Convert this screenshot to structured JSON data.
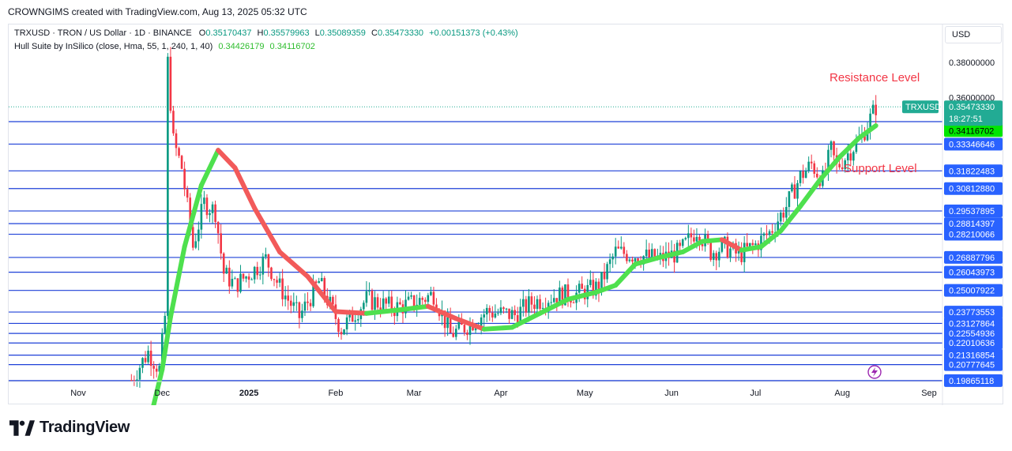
{
  "header": {
    "title": "CROWNGIMS created with TradingView.com, Aug 13, 2025 05:32 UTC"
  },
  "legend": {
    "symbol": "TRXUSD · TRON / US Dollar · 1D · BINANCE",
    "o_label": "O",
    "o_value": "0.35170437",
    "h_label": "H",
    "h_value": "0.35579963",
    "l_label": "L",
    "l_value": "0.35089359",
    "c_label": "C",
    "c_value": "0.35473330",
    "change": "+0.00151373 (+0.43%)",
    "indicator": "Hull Suite by InSilico (close, Hma, 55, 1, 240, 1, 40)",
    "indicator_v1": "0.34426179",
    "indicator_v2": "0.34116702"
  },
  "currency": "USD",
  "logo_text": "TradingView",
  "chart_data": {
    "type": "candlestick",
    "symbol": "TRXUSD",
    "ylim": [
      0.195,
      0.385
    ],
    "price_axis_labels": [
      "0.38000000",
      "0.36000000"
    ],
    "x_tick_labels": [
      "Nov",
      "Dec",
      "2025",
      "Feb",
      "Mar",
      "Apr",
      "May",
      "Jun",
      "Jul",
      "Aug",
      "Sep"
    ],
    "last_price": {
      "symbol": "TRXUSD",
      "value": 0.3547333,
      "label": "0.35473330",
      "countdown": "18:27:51"
    },
    "horizontal_levels": [
      {
        "value": 0.34628566,
        "label": "0.34628566"
      },
      {
        "value": 0.33346646,
        "label": "0.33346646"
      },
      {
        "value": 0.31822483,
        "label": "0.31822483"
      },
      {
        "value": 0.3081288,
        "label": "0.30812880"
      },
      {
        "value": 0.29537895,
        "label": "0.29537895"
      },
      {
        "value": 0.28814397,
        "label": "0.28814397"
      },
      {
        "value": 0.28210066,
        "label": "0.28210066"
      },
      {
        "value": 0.26887796,
        "label": "0.26887796"
      },
      {
        "value": 0.26043973,
        "label": "0.26043973"
      },
      {
        "value": 0.25007922,
        "label": "0.25007922"
      },
      {
        "value": 0.23773553,
        "label": "0.23773553"
      },
      {
        "value": 0.23127864,
        "label": "0.23127864"
      },
      {
        "value": 0.22554936,
        "label": "0.22554936"
      },
      {
        "value": 0.22010636,
        "label": "0.22010636"
      },
      {
        "value": 0.21316854,
        "label": "0.21316854"
      },
      {
        "value": 0.20777645,
        "label": "0.20777645"
      },
      {
        "value": 0.19865118,
        "label": "0.19865118"
      }
    ],
    "indicator_labels": [
      {
        "value": 0.34426179,
        "label": "0.34426179"
      },
      {
        "value": 0.34116702,
        "label": "0.34116702"
      }
    ],
    "annotations": [
      {
        "text": "Resistance Level",
        "color": "#f23645"
      },
      {
        "text": "Support Level",
        "color": "#f23645"
      }
    ],
    "hull_series": [
      {
        "date": "2024-11-25",
        "value": 0.165
      },
      {
        "date": "2024-12-01",
        "value": 0.205
      },
      {
        "date": "2024-12-04",
        "value": 0.235
      },
      {
        "date": "2024-12-09",
        "value": 0.275
      },
      {
        "date": "2024-12-15",
        "value": 0.31
      },
      {
        "date": "2024-12-21",
        "value": 0.33
      },
      {
        "date": "2024-12-27",
        "value": 0.32
      },
      {
        "date": "2025-01-03",
        "value": 0.297
      },
      {
        "date": "2025-01-12",
        "value": 0.272
      },
      {
        "date": "2025-01-22",
        "value": 0.258
      },
      {
        "date": "2025-02-01",
        "value": 0.238
      },
      {
        "date": "2025-02-12",
        "value": 0.237
      },
      {
        "date": "2025-02-24",
        "value": 0.239
      },
      {
        "date": "2025-03-06",
        "value": 0.241
      },
      {
        "date": "2025-03-16",
        "value": 0.234
      },
      {
        "date": "2025-03-26",
        "value": 0.228
      },
      {
        "date": "2025-04-05",
        "value": 0.229
      },
      {
        "date": "2025-04-15",
        "value": 0.237
      },
      {
        "date": "2025-04-25",
        "value": 0.245
      },
      {
        "date": "2025-05-05",
        "value": 0.249
      },
      {
        "date": "2025-05-12",
        "value": 0.253
      },
      {
        "date": "2025-05-19",
        "value": 0.265
      },
      {
        "date": "2025-05-28",
        "value": 0.269
      },
      {
        "date": "2025-06-05",
        "value": 0.272
      },
      {
        "date": "2025-06-12",
        "value": 0.278
      },
      {
        "date": "2025-06-19",
        "value": 0.279
      },
      {
        "date": "2025-06-26",
        "value": 0.273
      },
      {
        "date": "2025-07-03",
        "value": 0.275
      },
      {
        "date": "2025-07-10",
        "value": 0.284
      },
      {
        "date": "2025-07-17",
        "value": 0.298
      },
      {
        "date": "2025-07-24",
        "value": 0.313
      },
      {
        "date": "2025-07-31",
        "value": 0.326
      },
      {
        "date": "2025-08-07",
        "value": 0.337
      },
      {
        "date": "2025-08-13",
        "value": 0.344
      }
    ],
    "price_path": [
      {
        "date": "2024-11-20",
        "value": 0.199
      },
      {
        "date": "2024-11-26",
        "value": 0.215
      },
      {
        "date": "2024-11-30",
        "value": 0.205
      },
      {
        "date": "2024-12-02",
        "value": 0.235
      },
      {
        "date": "2024-12-03",
        "value": 0.38
      },
      {
        "date": "2024-12-05",
        "value": 0.335
      },
      {
        "date": "2024-12-08",
        "value": 0.32
      },
      {
        "date": "2024-12-12",
        "value": 0.275
      },
      {
        "date": "2024-12-16",
        "value": 0.3
      },
      {
        "date": "2024-12-20",
        "value": 0.295
      },
      {
        "date": "2024-12-23",
        "value": 0.26
      },
      {
        "date": "2024-12-27",
        "value": 0.253
      },
      {
        "date": "2025-01-03",
        "value": 0.262
      },
      {
        "date": "2025-01-07",
        "value": 0.268
      },
      {
        "date": "2025-01-12",
        "value": 0.252
      },
      {
        "date": "2025-01-19",
        "value": 0.235
      },
      {
        "date": "2025-01-26",
        "value": 0.255
      },
      {
        "date": "2025-02-03",
        "value": 0.228
      },
      {
        "date": "2025-02-12",
        "value": 0.245
      },
      {
        "date": "2025-02-22",
        "value": 0.24
      },
      {
        "date": "2025-03-01",
        "value": 0.243
      },
      {
        "date": "2025-03-08",
        "value": 0.248
      },
      {
        "date": "2025-03-14",
        "value": 0.225
      },
      {
        "date": "2025-03-20",
        "value": 0.23
      },
      {
        "date": "2025-03-27",
        "value": 0.238
      },
      {
        "date": "2025-04-06",
        "value": 0.236
      },
      {
        "date": "2025-04-12",
        "value": 0.243
      },
      {
        "date": "2025-04-20",
        "value": 0.247
      },
      {
        "date": "2025-04-28",
        "value": 0.248
      },
      {
        "date": "2025-05-06",
        "value": 0.252
      },
      {
        "date": "2025-05-12",
        "value": 0.272
      },
      {
        "date": "2025-05-20",
        "value": 0.27
      },
      {
        "date": "2025-05-28",
        "value": 0.268
      },
      {
        "date": "2025-06-04",
        "value": 0.272
      },
      {
        "date": "2025-06-10",
        "value": 0.285
      },
      {
        "date": "2025-06-15",
        "value": 0.272
      },
      {
        "date": "2025-06-20",
        "value": 0.275
      },
      {
        "date": "2025-06-25",
        "value": 0.27
      },
      {
        "date": "2025-07-01",
        "value": 0.276
      },
      {
        "date": "2025-07-06",
        "value": 0.283
      },
      {
        "date": "2025-07-12",
        "value": 0.298
      },
      {
        "date": "2025-07-17",
        "value": 0.315
      },
      {
        "date": "2025-07-21",
        "value": 0.322
      },
      {
        "date": "2025-07-25",
        "value": 0.313
      },
      {
        "date": "2025-07-28",
        "value": 0.33
      },
      {
        "date": "2025-07-30",
        "value": 0.32
      },
      {
        "date": "2025-08-03",
        "value": 0.328
      },
      {
        "date": "2025-08-08",
        "value": 0.338
      },
      {
        "date": "2025-08-13",
        "value": 0.3547
      }
    ]
  },
  "colors": {
    "level_line": "#1e40d8",
    "candle_up": "#089981",
    "candle_down": "#f23645",
    "hull_up": "#4ee04e",
    "hull_down": "#f25a5a",
    "label_blue": "#2962ff",
    "label_green": "#00e600",
    "last_price": "#22ab94",
    "annotation": "#f23645"
  }
}
